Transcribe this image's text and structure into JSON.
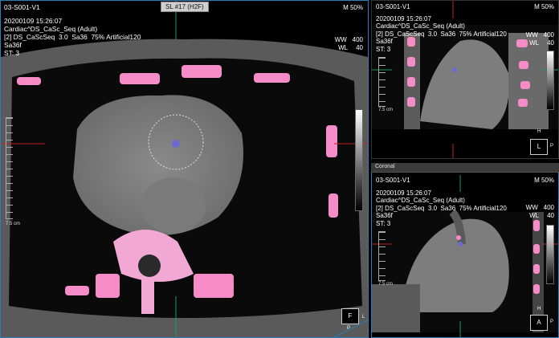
{
  "slice_tag": "SL #17 (H2F)",
  "patient": {
    "id": "03-S001-V1",
    "datetime": "20200109 15:26:07",
    "study": "Cardiac^DS_CaSc_Seq (Adult)",
    "series": "[2] DS_CaScSeq  3.0  Sa36  75% Artificial120",
    "kernel": "Sa36f",
    "st": "ST: 3"
  },
  "main": {
    "magnification": "M 50%",
    "ruler": "7.5 cm",
    "orient_box": "F",
    "orient_right": "L",
    "orient_bottom": "P"
  },
  "sagittal": {
    "magnification": "M 50%",
    "ww_label": "WW",
    "ww": "400",
    "wl_label": "WL",
    "wl": "40",
    "ruler": "7.5 cm",
    "orient_top": "H",
    "orient_box": "L",
    "orient_right": "P"
  },
  "coronal": {
    "title": "Coronal",
    "magnification": "M 50%",
    "ww_label": "WW",
    "ww": "400",
    "wl_label": "WL",
    "wl": "40",
    "ruler": "7.5 cm",
    "orient_top": "H",
    "orient_box": "A",
    "orient_right": "P"
  },
  "main_window": {
    "ww_label": "WW",
    "ww": "400",
    "wl_label": "WL",
    "wl": "40"
  },
  "colors": {
    "active_border": "#2a7fb8",
    "calcium_overlay": "#f58cc8",
    "crosshair_red": "#c02020",
    "crosshair_green": "#1f9a5a"
  }
}
